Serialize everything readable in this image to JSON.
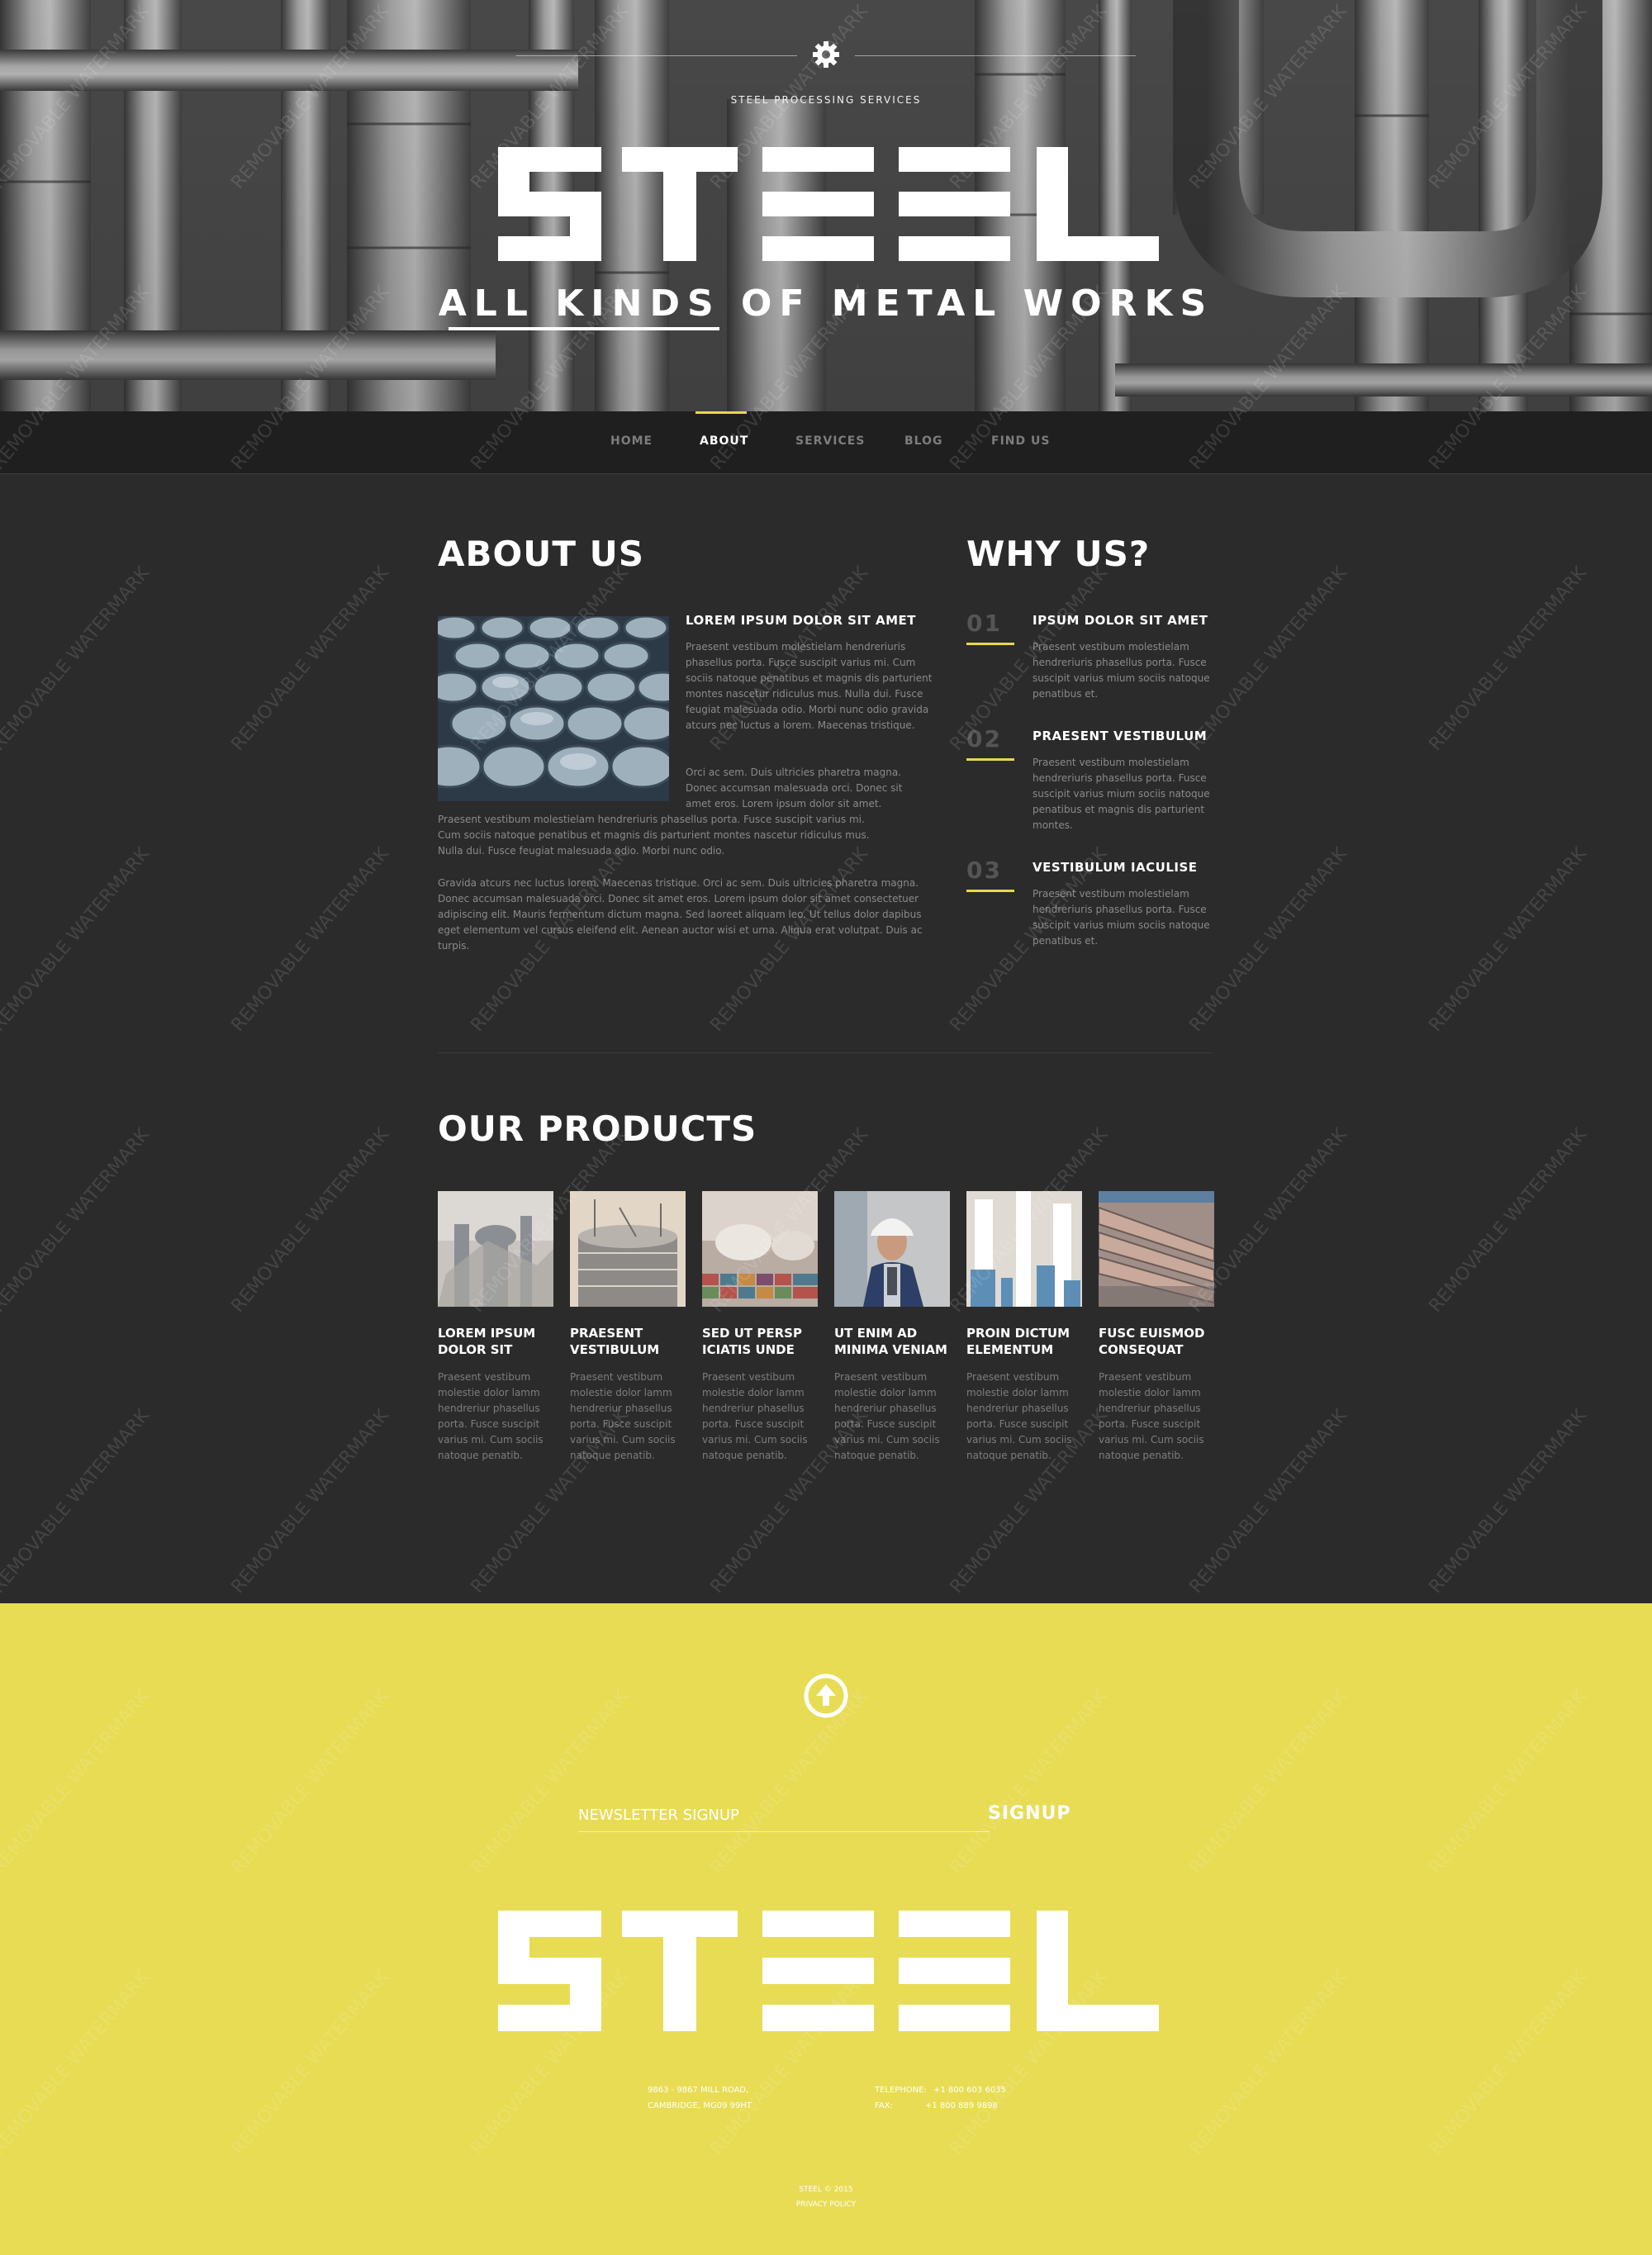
{
  "hero": {
    "tagline": "STEEL PROCESSING SERVICES",
    "logo_text": "STEEL",
    "subtitle": "ALL KINDS OF METAL WORKS"
  },
  "nav": {
    "items": [
      {
        "label": "HOME",
        "active": false
      },
      {
        "label": "ABOUT",
        "active": true
      },
      {
        "label": "SERVICES",
        "active": false
      },
      {
        "label": "BLOG",
        "active": false
      },
      {
        "label": "FIND US",
        "active": false
      }
    ],
    "accent": "#e8d84a"
  },
  "about": {
    "title": "ABOUT US",
    "subheading": "LOREM IPSUM DOLOR SIT AMET",
    "para1": "Praesent vestibum molestielam hendreriuris phasellus porta. Fusce suscipit varius mi. Cum sociis natoque penatibus et magnis dis parturient montes nascetur ridiculus mus. Nulla dui. Fusce feugiat malesuada odio. Morbi nunc odio gravida atcurs nec luctus a lorem. Maecenas tristique.",
    "para2_lines": [
      "Orci ac sem. Duis ultricies pharetra magna.",
      "Donec accumsan malesuada orci. Donec sit",
      "amet eros. Lorem ipsum dolor sit amet.",
      "Praesent vestibum molestielam hendreriuris phasellus porta. Fusce suscipit varius mi.",
      "Cum sociis natoque penatibus et magnis dis parturient montes nascetur ridiculus mus.",
      "Nulla dui. Fusce feugiat malesuada odio. Morbi nunc odio."
    ],
    "para3": "Gravida atcurs nec luctus lorem. Maecenas tristique. Orci ac sem. Duis ultricies pharetra magna. Donec accumsan malesuada orci. Donec sit amet eros. Lorem ipsum dolor sit amet consectetuer adipiscing elit. Mauris fermentum dictum magna. Sed laoreet aliquam leo. Ut tellus dolor dapibus eget elementum vel cursus eleifend elit. Aenean auctor wisi et urna. Aliqua erat volutpat. Duis ac turpis."
  },
  "why": {
    "title": "WHY US?",
    "items": [
      {
        "num": "01",
        "title": "IPSUM DOLOR SIT AMET",
        "text": "Praesent vestibum molestielam hendreriuris phasellus porta. Fusce suscipit varius mium sociis natoque penatibus et."
      },
      {
        "num": "02",
        "title": "PRAESENT VESTIBULUM",
        "text": "Praesent vestibum molestielam hendreriuris phasellus porta. Fusce suscipit varius mium sociis natoque penatibus et magnis dis parturient montes."
      },
      {
        "num": "03",
        "title": "VESTIBULUM IACULISE",
        "text": "Praesent vestibum molestielam hendreriuris phasellus porta. Fusce suscipit varius mium sociis natoque penatibus et."
      }
    ]
  },
  "products": {
    "title": "OUR PRODUCTS",
    "items": [
      {
        "title_line1": "LOREM IPSUM",
        "title_line2": "DOLOR SIT",
        "text": "Praesent vestibum molestie dolor lamm hendreriur phasellus porta. Fusce suscipit varius mi. Cum sociis natoque penatib."
      },
      {
        "title_line1": "PRAESENT",
        "title_line2": "VESTIBULUM",
        "text": "Praesent vestibum molestie dolor lamm hendreriur phasellus porta. Fusce suscipit varius mi. Cum sociis natoque penatib."
      },
      {
        "title_line1": "SED UT PERSP",
        "title_line2": "ICIATIS UNDE",
        "text": "Praesent vestibum molestie dolor lamm hendreriur phasellus porta. Fusce suscipit varius mi. Cum sociis natoque penatib."
      },
      {
        "title_line1": "UT ENIM AD",
        "title_line2": "MINIMA VENIAM",
        "text": "Praesent vestibum molestie dolor lamm hendreriur phasellus porta. Fusce suscipit varius mi. Cum sociis natoque penatib."
      },
      {
        "title_line1": "PROIN DICTUM",
        "title_line2": "ELEMENTUM",
        "text": "Praesent vestibum molestie dolor lamm hendreriur phasellus porta. Fusce suscipit varius mi. Cum sociis natoque penatib."
      },
      {
        "title_line1": "FUSC EUISMOD",
        "title_line2": "CONSEQUAT",
        "text": "Praesent vestibum molestie dolor lamm hendreriur phasellus porta. Fusce suscipit varius mi. Cum sociis natoque penatib."
      }
    ]
  },
  "footer": {
    "newsletter_placeholder": "NEWSLETTER SIGNUP",
    "signup_label": "SIGNUP",
    "logo_text": "STEEL",
    "address_line1": "9863 - 9867 MILL ROAD,",
    "address_line2": "CAMBRIDGE, MG09 99HT",
    "tel_label": "TELEPHONE:",
    "tel_value": "+1 800 603 6035",
    "fax_label": "FAX:",
    "fax_value": "+1 800 889 9898",
    "copyright": "STEEL © 2015",
    "privacy": "PRIVACY POLICY",
    "bg_color": "#e8dc54"
  },
  "watermark_text": "REMOVABLE WATERMARK"
}
